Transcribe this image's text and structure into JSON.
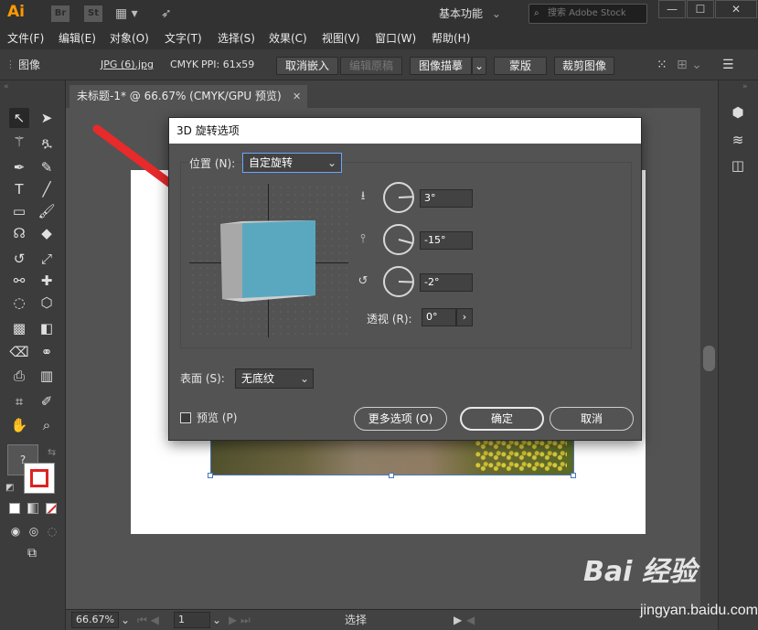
{
  "titlebar": {
    "app_logo": "Ai",
    "br_badge": "Br",
    "st_badge": "St",
    "layout_icon": "grid-layout-icon",
    "rocket_icon": "rocket-icon",
    "workspace": "基本功能",
    "search_placeholder": "搜索 Adobe Stock",
    "min_label": "—",
    "max_label": "☐",
    "close_label": "✕"
  },
  "menu": [
    "文件(F)",
    "编辑(E)",
    "对象(O)",
    "文字(T)",
    "选择(S)",
    "效果(C)",
    "视图(V)",
    "窗口(W)",
    "帮助(H)"
  ],
  "controlbar": {
    "type_label": "图像",
    "file_name": "JPG (6).jpg",
    "color_mode": "CMYK",
    "ppi": "PPI: 61x59",
    "unembed_btn": "取消嵌入",
    "edit_original_btn": "编辑原稿",
    "image_trace_btn": "图像描摹",
    "mask_btn": "蒙版",
    "crop_btn": "裁剪图像"
  },
  "document_tab": {
    "label": "未标题-1* @ 66.67% (CMYK/GPU 预览)",
    "close": "✕"
  },
  "dialog": {
    "title": "3D 旋转选项",
    "position_label": "位置 (N):",
    "position_value": "自定旋转",
    "x_rotation": "3°",
    "y_rotation": "-15°",
    "z_rotation": "-2°",
    "perspective_label": "透视 (R):",
    "perspective_value": "0°",
    "surface_label": "表面 (S):",
    "surface_value": "无底纹",
    "preview_label": "预览 (P)",
    "more_options_btn": "更多选项 (O)",
    "ok_btn": "确定",
    "cancel_btn": "取消",
    "cube_face_color": "#5aa8c0",
    "cube_side_color": "#a8a8a8"
  },
  "statusbar": {
    "zoom": "66.67%",
    "page": "1",
    "tool": "选择"
  },
  "watermark": {
    "main": "Bai 经验",
    "sub": "jingyan.baidu.com"
  },
  "colors": {
    "ui_bg": "#535353",
    "panel_bg": "#3c3c3c",
    "titlebar_bg": "#323232",
    "annotation_arrow": "#e82a2a"
  }
}
